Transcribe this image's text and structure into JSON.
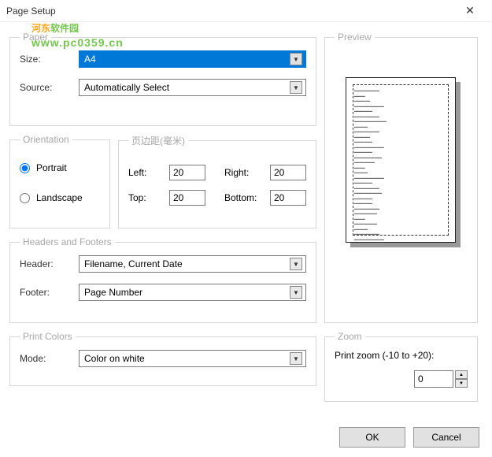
{
  "window": {
    "title": "Page Setup",
    "close": "✕"
  },
  "watermark": {
    "cn_part1": "河东",
    "cn_part2": "软件园",
    "url": "www.pc0359.cn"
  },
  "paper": {
    "legend": "Paper",
    "size_label": "Size:",
    "size_value": "A4",
    "source_label": "Source:",
    "source_value": "Automatically Select"
  },
  "orientation": {
    "legend": "Orientation",
    "portrait": "Portrait",
    "landscape": "Landscape",
    "selected": "portrait"
  },
  "margins": {
    "legend": "页边距(毫米)",
    "left_label": "Left:",
    "left_value": "20",
    "right_label": "Right:",
    "right_value": "20",
    "top_label": "Top:",
    "top_value": "20",
    "bottom_label": "Bottom:",
    "bottom_value": "20"
  },
  "headers": {
    "legend": "Headers and Footers",
    "header_label": "Header:",
    "header_value": "Filename, Current Date",
    "footer_label": "Footer:",
    "footer_value": "Page Number"
  },
  "print_colors": {
    "legend": "Print Colors",
    "mode_label": "Mode:",
    "mode_value": "Color on white"
  },
  "preview": {
    "legend": "Preview"
  },
  "zoom": {
    "legend": "Zoom",
    "label": "Print zoom (-10 to +20):",
    "value": "0"
  },
  "buttons": {
    "ok": "OK",
    "cancel": "Cancel"
  }
}
